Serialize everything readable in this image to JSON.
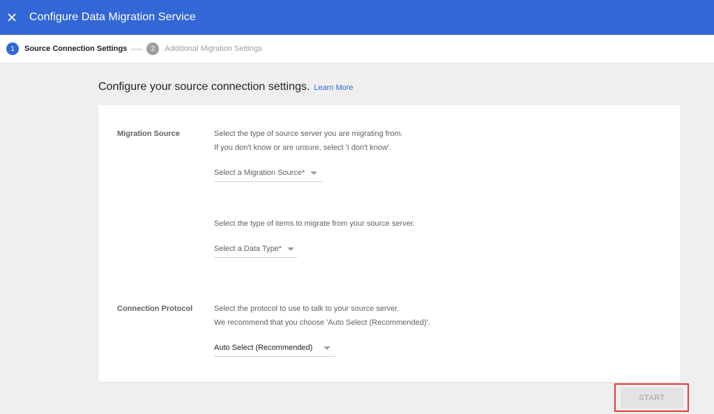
{
  "header": {
    "title": "Configure Data Migration Service",
    "close_icon": "close-icon"
  },
  "stepper": {
    "steps": [
      {
        "number": "1",
        "label": "Source Connection Settings",
        "state": "active"
      },
      {
        "number": "2",
        "label": "Additional Migration Settings",
        "state": "inactive"
      }
    ]
  },
  "main": {
    "heading": "Configure your source connection settings.",
    "learn_more": "Learn More"
  },
  "form": {
    "migration_source": {
      "label": "Migration Source",
      "desc_line1": "Select the type of source server you are migrating from.",
      "desc_line2": "If you don't know or are unsure, select 'I don't know'.",
      "select_value": "Select a Migration Source*"
    },
    "data_type": {
      "desc": "Select the type of items to migrate from your source server.",
      "select_value": "Select a Data Type*"
    },
    "connection_protocol": {
      "label": "Connection Protocol",
      "desc_line1": "Select the protocol to use to talk to your source server.",
      "desc_line2": "We recommend that you choose 'Auto Select (Recommended)'.",
      "select_value": "Auto Select (Recommended)"
    }
  },
  "footer": {
    "start_label": "START"
  },
  "colors": {
    "brand": "#3367d6",
    "highlight": "#e53935",
    "inactive": "#9e9e9e"
  }
}
